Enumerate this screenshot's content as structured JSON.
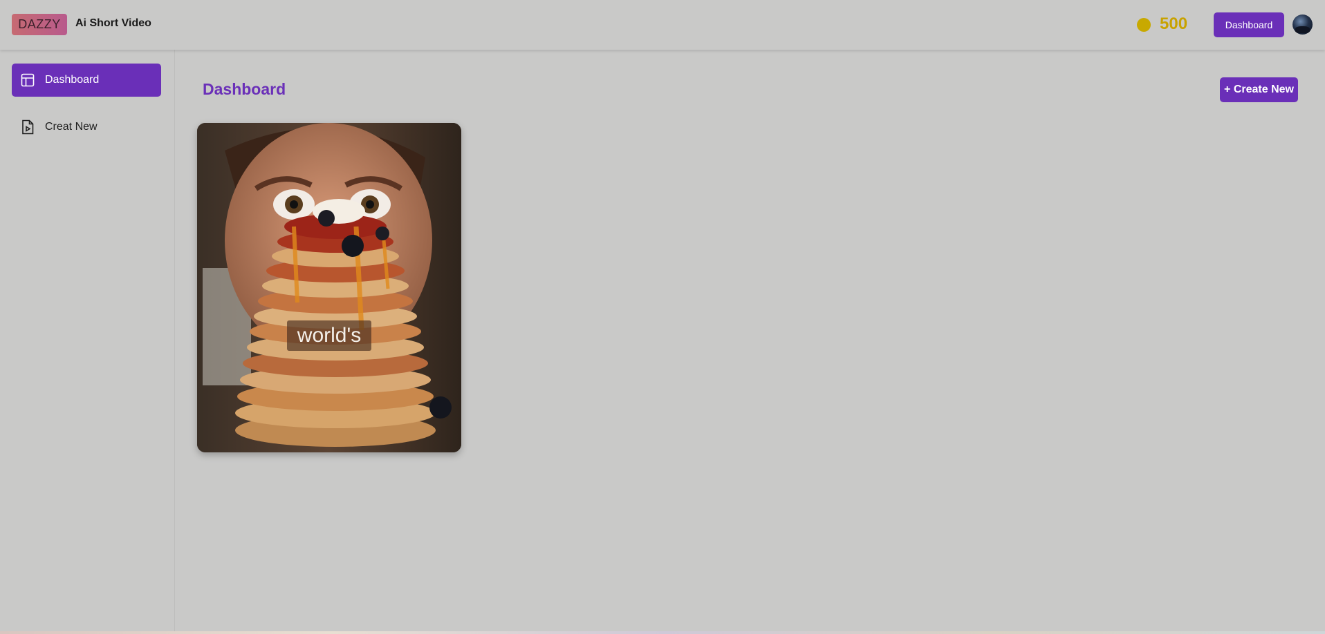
{
  "header": {
    "logo_text": "DAZZY",
    "app_name": "Ai Short Video",
    "credits": "500",
    "dashboard_button": "Dashboard"
  },
  "sidebar": {
    "items": [
      {
        "label": "Dashboard",
        "icon": "layout-icon",
        "active": true
      },
      {
        "label": "Creat New",
        "icon": "file-video-icon",
        "active": false
      }
    ]
  },
  "main": {
    "title": "Dashboard",
    "create_button": "+ Create New",
    "videos": [
      {
        "caption": "world's"
      }
    ]
  },
  "colors": {
    "accent": "#6a2fb8",
    "coin": "#c8a200",
    "background": "#c9c9c8"
  }
}
